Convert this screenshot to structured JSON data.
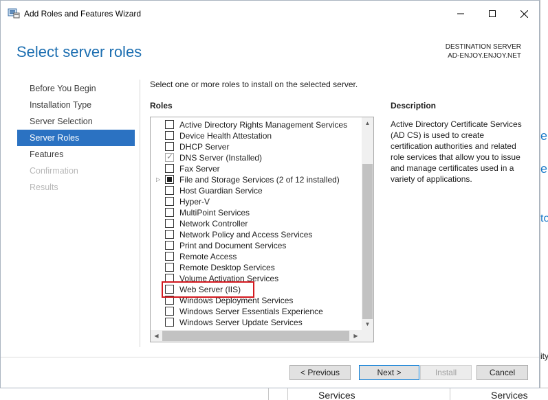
{
  "window": {
    "title": "Add Roles and Features Wizard"
  },
  "header": {
    "page_title": "Select server roles",
    "destination_label": "DESTINATION SERVER",
    "destination_server": "AD-ENJOY.ENJOY.NET"
  },
  "nav": {
    "items": [
      {
        "label": "Before You Begin"
      },
      {
        "label": "Installation Type"
      },
      {
        "label": "Server Selection"
      },
      {
        "label": "Server Roles"
      },
      {
        "label": "Features"
      },
      {
        "label": "Confirmation"
      },
      {
        "label": "Results"
      }
    ]
  },
  "main": {
    "instruction": "Select one or more roles to install on the selected server.",
    "roles_label": "Roles",
    "roles": [
      {
        "label": "Active Directory Rights Management Services"
      },
      {
        "label": "Device Health Attestation"
      },
      {
        "label": "DHCP Server"
      },
      {
        "label": "DNS Server (Installed)"
      },
      {
        "label": "Fax Server"
      },
      {
        "label": "File and Storage Services (2 of 12 installed)"
      },
      {
        "label": "Host Guardian Service"
      },
      {
        "label": "Hyper-V"
      },
      {
        "label": "MultiPoint Services"
      },
      {
        "label": "Network Controller"
      },
      {
        "label": "Network Policy and Access Services"
      },
      {
        "label": "Print and Document Services"
      },
      {
        "label": "Remote Access"
      },
      {
        "label": "Remote Desktop Services"
      },
      {
        "label": "Volume Activation Services"
      },
      {
        "label": "Web Server (IIS)"
      },
      {
        "label": "Windows Deployment Services"
      },
      {
        "label": "Windows Server Essentials Experience"
      },
      {
        "label": "Windows Server Update Services"
      }
    ]
  },
  "description": {
    "label": "Description",
    "text": "Active Directory Certificate Services (AD CS) is used to create certification authorities and related role services that allow you to issue and manage certificates used in a variety of applications."
  },
  "buttons": {
    "previous": "< Previous",
    "next": "Next >",
    "install": "Install",
    "cancel": "Cancel"
  },
  "background": {
    "services_left": "Services",
    "services_right": "Services",
    "edge_1": "e",
    "edge_2": "e",
    "edge_3": "to",
    "edge_4": "ity"
  },
  "colors": {
    "accent": "#2b72c2",
    "title_blue": "#1d6fb1",
    "highlight_red": "#d3181e"
  }
}
